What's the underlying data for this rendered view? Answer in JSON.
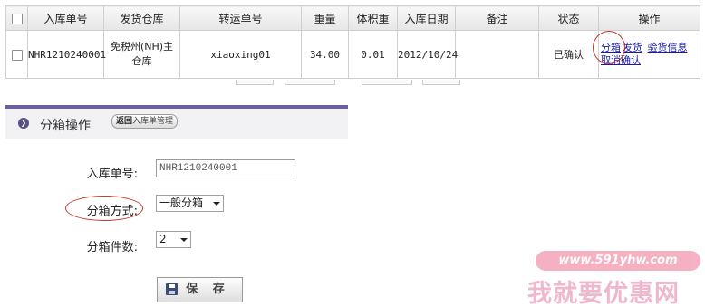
{
  "table": {
    "headers": [
      "入库单号",
      "发货仓库",
      "转运单号",
      "重量",
      "体积重",
      "入库日期",
      "备注",
      "状态",
      "操作"
    ],
    "row": {
      "order_no": "NHR1210240001",
      "warehouse": "免税州(NH)主仓库",
      "transfer_no": "xiaoxing01",
      "weight": "34.00",
      "volume_weight": "0.01",
      "date": "2012/10/24",
      "remark": "",
      "status": "已确认",
      "actions": {
        "split": "分箱",
        "ship": "发货",
        "inspect": "验货信息",
        "cancel": "取消确认"
      }
    }
  },
  "panel": {
    "title": "分箱操作",
    "back_label": "返回",
    "back_sub": "入库单管理"
  },
  "form": {
    "order_no_label": "入库单号:",
    "order_no_value": "NHR1210240001",
    "method_label": "分箱方式:",
    "method_value": "一般分箱",
    "count_label": "分箱件数:",
    "count_value": "2",
    "save_label": "保 存"
  },
  "watermark": {
    "url": "www.591yhw.com",
    "name": "我就要优惠网"
  },
  "colors": {
    "accent": "#6c5ea1",
    "link": "#1a1aa6",
    "annotation": "#c0392b"
  }
}
